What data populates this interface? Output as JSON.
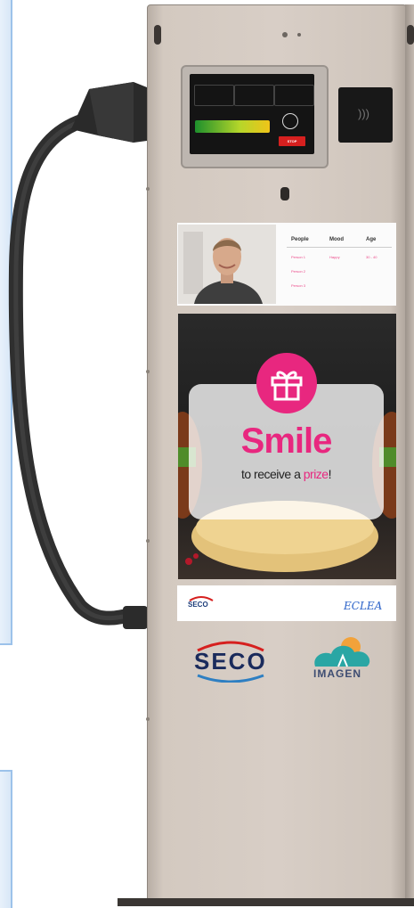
{
  "display": {
    "top_left": "",
    "top_center": "",
    "cells": [
      {
        "title": "",
        "value": ""
      },
      {
        "title": "",
        "value": ""
      },
      {
        "title": "",
        "value": ""
      }
    ],
    "charge_label": "",
    "stop_label": "STOP"
  },
  "analytics": {
    "headers": [
      "People",
      "Mood",
      "Age"
    ],
    "rows": [
      {
        "person": "Person 1",
        "mood": "Happy",
        "age": "30 - 40"
      },
      {
        "person": "Person 2",
        "mood": "",
        "age": ""
      },
      {
        "person": "Person 3",
        "mood": "",
        "age": ""
      }
    ]
  },
  "ad": {
    "headline": "Smile",
    "tagline_before": "to receive a ",
    "tagline_highlight": "prize",
    "tagline_after": "!"
  },
  "logos": {
    "strip_left": "SECO",
    "strip_right": "ECLEA",
    "big_left": "SECO",
    "big_right": "IMAGEN"
  },
  "colors": {
    "accent_pink": "#e8277f",
    "kiosk_body": "#d8cec6",
    "stop_red": "#d6201f",
    "seco_navy": "#1a2b5c"
  },
  "icons": [
    "gift-icon",
    "contactless-icon",
    "charge-plug-icon"
  ]
}
